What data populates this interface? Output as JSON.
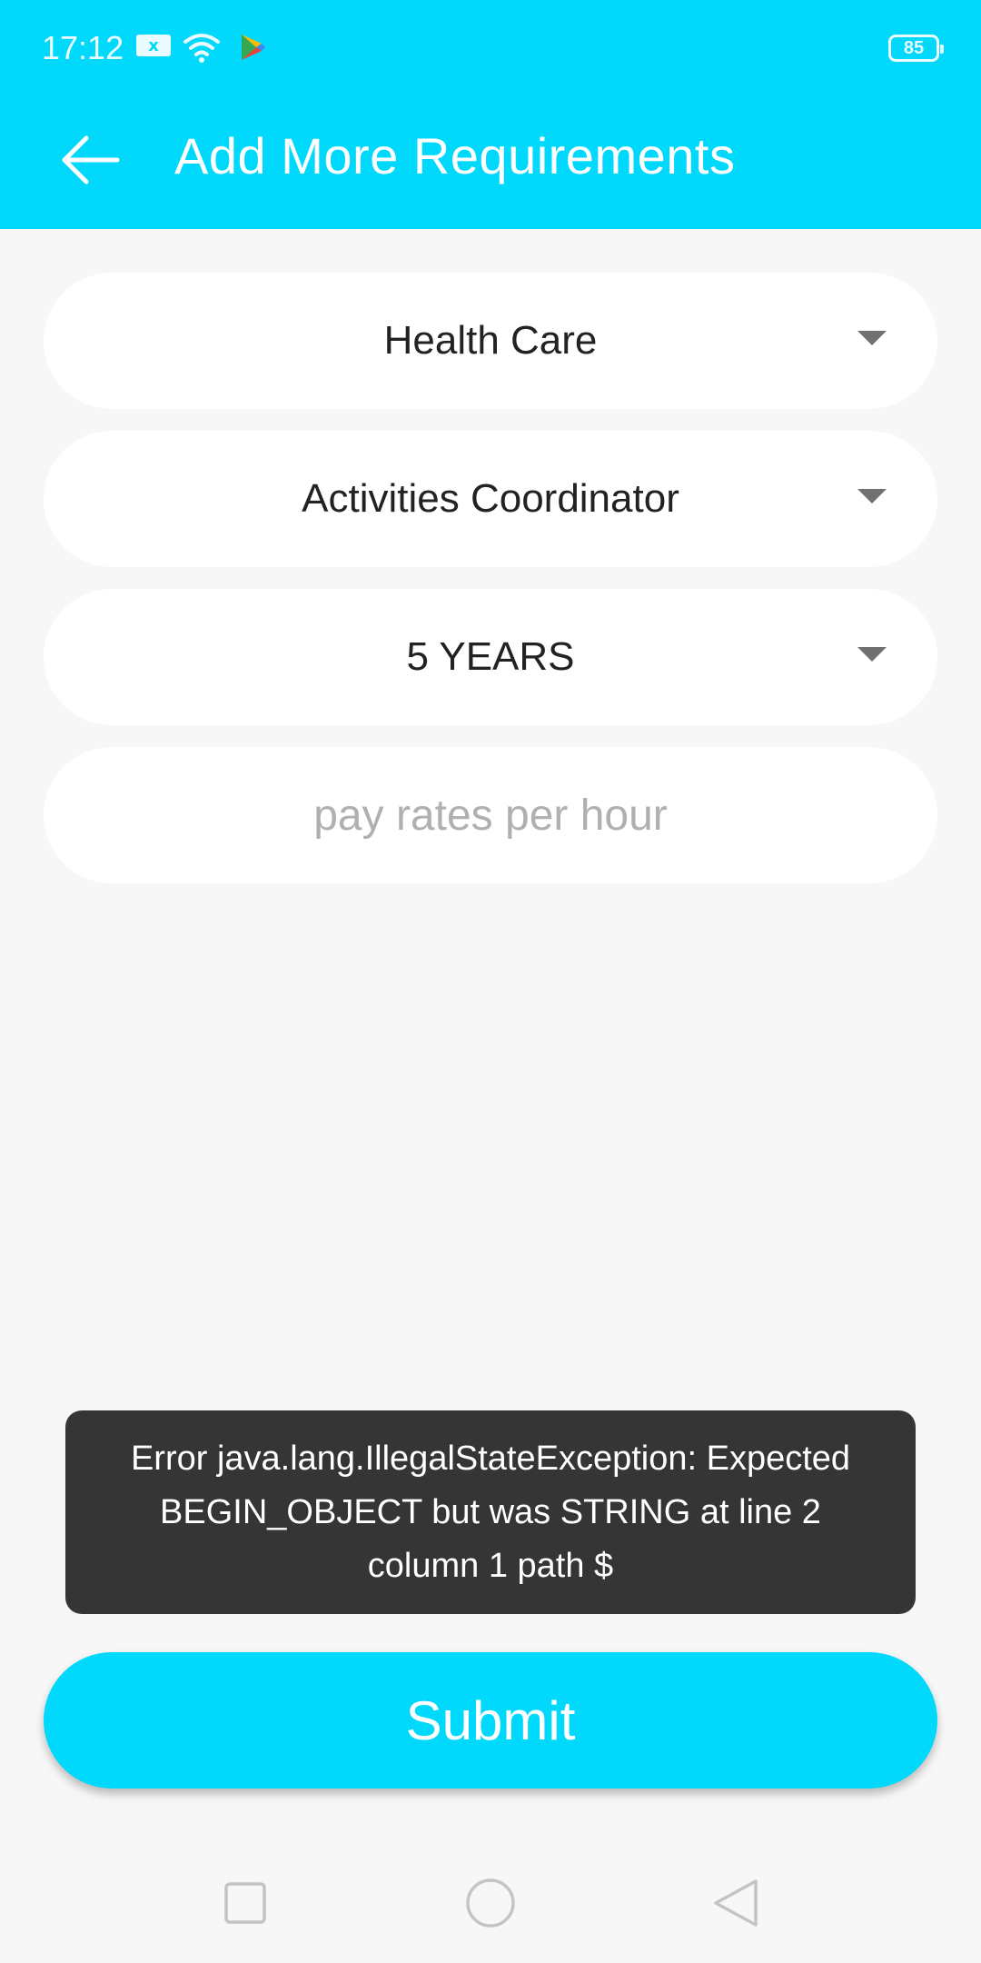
{
  "status_bar": {
    "time": "17:12",
    "battery": "85",
    "icons": [
      "sim-icon",
      "wifi-icon",
      "play-store-icon",
      "battery-icon"
    ]
  },
  "toolbar": {
    "title": "Add More Requirements",
    "back_icon": "arrow-left-icon"
  },
  "form": {
    "category": {
      "selected": "Health Care"
    },
    "role": {
      "selected": "Activities Coordinator"
    },
    "experience": {
      "selected": "5 YEARS"
    },
    "pay_rate": {
      "placeholder": "pay rates per hour",
      "value": ""
    }
  },
  "toast": {
    "message": "Error java.lang.IllegalStateException: Expected BEGIN_OBJECT but was STRING at line 2 column 1 path $"
  },
  "submit": {
    "label": "Submit"
  },
  "nav_bar": {
    "icons": [
      "recents-icon",
      "home-icon",
      "back-icon"
    ]
  },
  "colors": {
    "accent": "#00d8fc",
    "background": "#f7f7f7",
    "toast_bg": "#353535"
  }
}
